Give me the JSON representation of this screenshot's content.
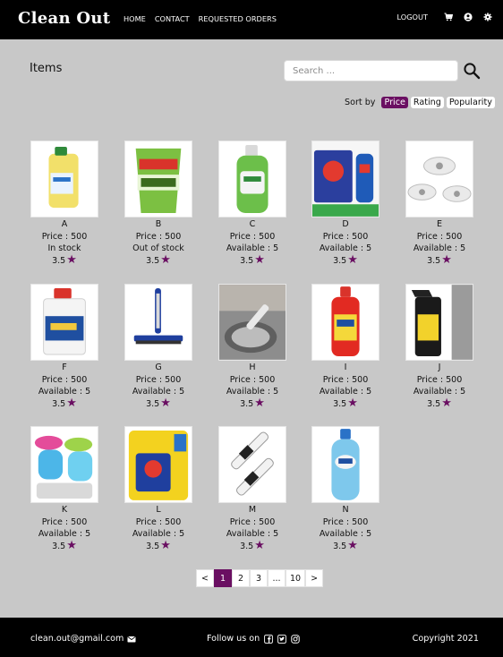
{
  "header": {
    "brand": "Clean Out",
    "nav": [
      "HOME",
      "CONTACT",
      "REQUESTED ORDERS"
    ],
    "logout": "LOGOUT",
    "icons": [
      "cart-icon",
      "user-icon",
      "settings-icon"
    ]
  },
  "page_title": "Items",
  "search": {
    "placeholder": "Search ..."
  },
  "sort": {
    "label": "Sort by",
    "options": [
      "Price",
      "Rating",
      "Popularity"
    ],
    "active": "Price"
  },
  "products": [
    {
      "name": "A",
      "price": "Price : 500",
      "availability": "In stock",
      "rating": "3.5"
    },
    {
      "name": "B",
      "price": "Price : 500",
      "availability": "Out of stock",
      "rating": "3.5"
    },
    {
      "name": "C",
      "price": "Price : 500",
      "availability": "Available : 5",
      "rating": "3.5"
    },
    {
      "name": "D",
      "price": "Price : 500",
      "availability": "Available : 5",
      "rating": "3.5",
      "image_text": "Value Pack"
    },
    {
      "name": "E",
      "price": "Price : 500",
      "availability": "Available : 5",
      "rating": "3.5"
    },
    {
      "name": "F",
      "price": "Price : 500",
      "availability": "Available : 5",
      "rating": "3.5"
    },
    {
      "name": "G",
      "price": "Price : 500",
      "availability": "Available : 5",
      "rating": "3.5"
    },
    {
      "name": "H",
      "price": "Price : 500",
      "availability": "Available : 5",
      "rating": "3.5"
    },
    {
      "name": "I",
      "price": "Price : 500",
      "availability": "Available : 5",
      "rating": "3.5"
    },
    {
      "name": "J",
      "price": "Price : 500",
      "availability": "Available : 5",
      "rating": "3.5"
    },
    {
      "name": "K",
      "price": "Price : 500",
      "availability": "Available : 5",
      "rating": "3.5"
    },
    {
      "name": "L",
      "price": "Price : 500",
      "availability": "Available : 5",
      "rating": "3.5"
    },
    {
      "name": "M",
      "price": "Price : 500",
      "availability": "Available : 5",
      "rating": "3.5"
    },
    {
      "name": "N",
      "price": "Price : 500",
      "availability": "Available : 5",
      "rating": "3.5"
    }
  ],
  "pagination": {
    "prev": "<",
    "pages": [
      "1",
      "2",
      "3",
      "...",
      "10"
    ],
    "next": ">",
    "current": "1"
  },
  "footer": {
    "email": "clean.out@gmail.com",
    "follow": "Follow us on",
    "copyright": "Copyright 2021"
  },
  "colors": {
    "accent": "#6a0f62",
    "header_bg": "#000000",
    "page_bg": "#c8c8c8"
  }
}
